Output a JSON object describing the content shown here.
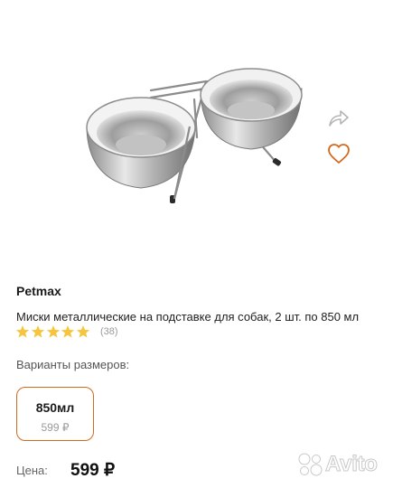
{
  "product": {
    "image": "stainless-steel-double-bowl-on-stand",
    "brand": "Petmax",
    "title": "Миски металлические на подставке для собак, 2 шт. по 850 мл",
    "rating": 5,
    "reviews_count": "(38)"
  },
  "actions": {
    "share_icon": "share-arrow-icon",
    "favorite_icon": "heart-icon"
  },
  "variants": {
    "label": "Варианты размеров:",
    "items": [
      {
        "size": "850мл",
        "price": "599 ₽",
        "selected": true
      }
    ]
  },
  "price": {
    "label": "Цена:",
    "value": "599 ₽"
  },
  "watermark": {
    "text": "Avito"
  },
  "colors": {
    "accent": "#d26a1e",
    "star": "#f7c53b",
    "muted_text": "#9a9a9a"
  }
}
